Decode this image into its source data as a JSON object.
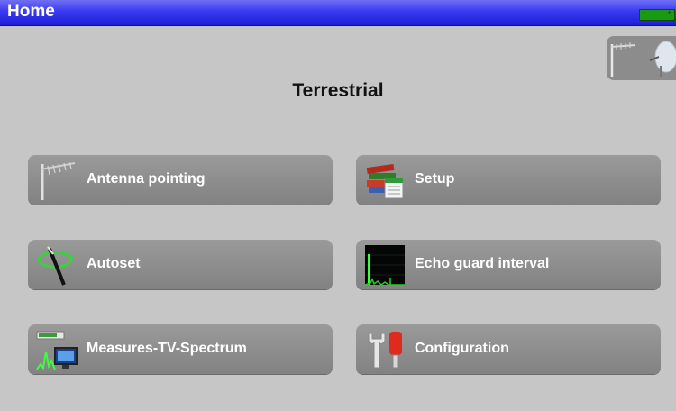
{
  "header": {
    "title": "Home",
    "battery_icon": "battery-icon",
    "battery_color": "#1a9a12"
  },
  "mode_switch": {
    "icons": [
      "terrestrial-antenna-icon",
      "satellite-dish-icon"
    ]
  },
  "page": {
    "title": "Terrestrial"
  },
  "menu": [
    {
      "label": "Antenna pointing",
      "icon": "antenna-icon"
    },
    {
      "label": "Setup",
      "icon": "books-setup-icon"
    },
    {
      "label": "Autoset",
      "icon": "autoset-icon"
    },
    {
      "label": "Echo guard interval",
      "icon": "echo-graph-icon"
    },
    {
      "label": "Measures-TV-Spectrum",
      "icon": "measures-spectrum-icon"
    },
    {
      "label": "Configuration",
      "icon": "wrench-config-icon"
    }
  ],
  "colors": {
    "background": "#c6c6c6",
    "title_bar": "#3a3af0",
    "button": "#8e8e8e",
    "button_text": "#ffffff"
  }
}
